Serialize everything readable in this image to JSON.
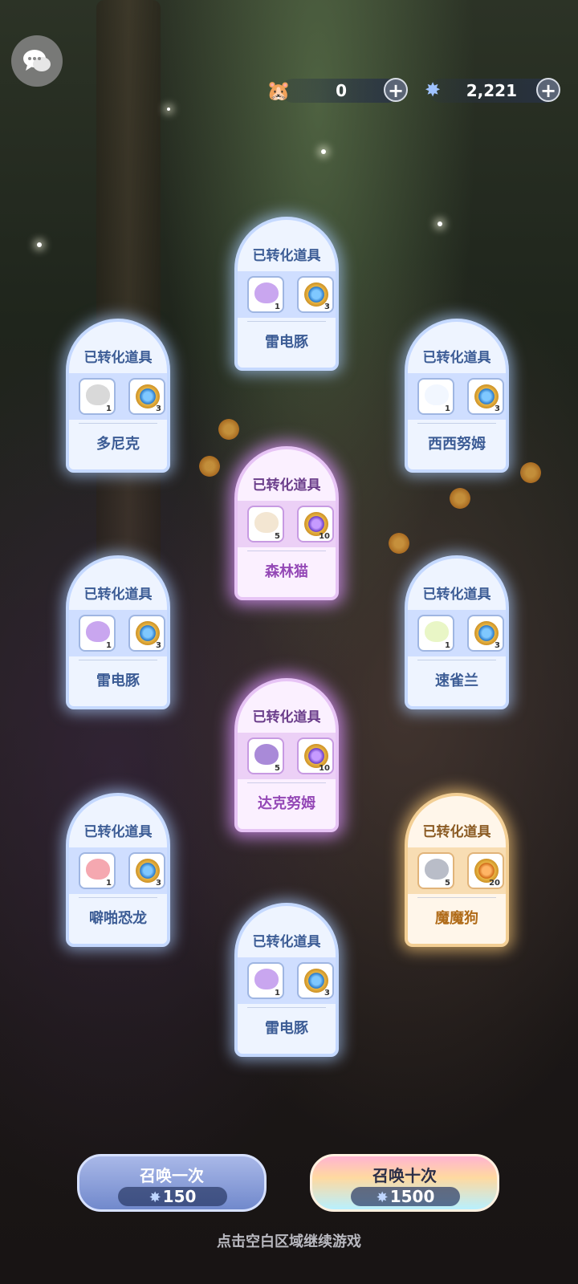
{
  "top_bar": {
    "chat_icon": "speech-bubbles-icon",
    "currency_a": {
      "icon": "pet-token-icon",
      "value": "0"
    },
    "currency_b": {
      "icon": "star-crystal-icon",
      "value": "2,221"
    },
    "plus_symbol": "+"
  },
  "cards": [
    {
      "title": "已转化道具",
      "name": "雷电豚",
      "pet_count": "1",
      "coin_count": "3",
      "rarity": "blue"
    },
    {
      "title": "已转化道具",
      "name": "多尼克",
      "pet_count": "1",
      "coin_count": "3",
      "rarity": "blue"
    },
    {
      "title": "已转化道具",
      "name": "西西努姆",
      "pet_count": "1",
      "coin_count": "3",
      "rarity": "blue"
    },
    {
      "title": "已转化道具",
      "name": "森林猫",
      "pet_count": "5",
      "coin_count": "10",
      "rarity": "purple"
    },
    {
      "title": "已转化道具",
      "name": "雷电豚",
      "pet_count": "1",
      "coin_count": "3",
      "rarity": "blue"
    },
    {
      "title": "已转化道具",
      "name": "速雀兰",
      "pet_count": "1",
      "coin_count": "3",
      "rarity": "blue"
    },
    {
      "title": "已转化道具",
      "name": "达克努姆",
      "pet_count": "5",
      "coin_count": "10",
      "rarity": "purple"
    },
    {
      "title": "已转化道具",
      "name": "噼啪恐龙",
      "pet_count": "1",
      "coin_count": "3",
      "rarity": "blue"
    },
    {
      "title": "已转化道具",
      "name": "魔魔狗",
      "pet_count": "5",
      "coin_count": "20",
      "rarity": "orange"
    },
    {
      "title": "已转化道具",
      "name": "雷电豚",
      "pet_count": "1",
      "coin_count": "3",
      "rarity": "blue"
    }
  ],
  "summon_once": {
    "label": "召唤一次",
    "cost": "150"
  },
  "summon_ten": {
    "label": "召唤十次",
    "cost": "1500"
  },
  "hint": "点击空白区域继续游戏",
  "colors": {
    "blue_accent": "#c5d9ff",
    "purple_accent": "#e7c4f5",
    "orange_accent": "#f3cf95"
  }
}
